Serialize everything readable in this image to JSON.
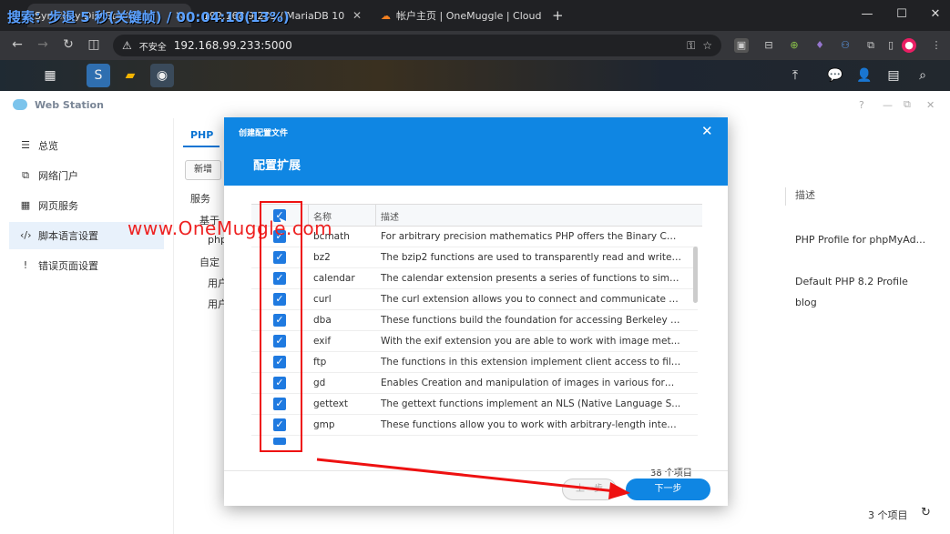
{
  "browser": {
    "overlay_text": "搜索：步退 5 秒(关键帧) / 00:04:10(13%)",
    "tabs": [
      {
        "label": "Synology DiskStation",
        "active": true
      },
      {
        "label": "192.168.9.233 / MariaDB 10",
        "active": false
      },
      {
        "label": "帐户主页 | OneMuggle | Cloud",
        "active": false
      }
    ],
    "new_tab": "+",
    "insecure_label": "不安全",
    "url": "192.168.99.233:5000"
  },
  "app": {
    "title": "Web Station",
    "sidebar": [
      {
        "label": "总览",
        "icon": "overview-icon"
      },
      {
        "label": "网络门户",
        "icon": "portal-icon"
      },
      {
        "label": "网页服务",
        "icon": "service-icon"
      },
      {
        "label": "脚本语言设置",
        "icon": "code-icon",
        "active": true
      },
      {
        "label": "错误页面设置",
        "icon": "error-page-icon"
      }
    ],
    "tab_php": "PHP",
    "add_button": "新增",
    "col_service": "服务",
    "col_desc": "描述",
    "group_based": "基于",
    "group_custom": "自定",
    "row_php": "php",
    "row_user1": "用户",
    "row_user2": "用户",
    "desc_1": "PHP Profile for phpMyAd...",
    "desc_2": "Default PHP 8.2 Profile",
    "desc_3": "blog",
    "footer_count": "3 个项目"
  },
  "modal": {
    "small_title": "创建配置文件",
    "big_title": "配置扩展",
    "col_name": "名称",
    "col_desc": "描述",
    "rows": [
      {
        "name": "bcmath",
        "desc": "For arbitrary precision mathematics PHP offers the Binary Cal..."
      },
      {
        "name": "bz2",
        "desc": "The bzip2 functions are used to transparently read and write ..."
      },
      {
        "name": "calendar",
        "desc": "The calendar extension presents a series of functions to simp..."
      },
      {
        "name": "curl",
        "desc": "The curl extension allows you to connect and communicate t..."
      },
      {
        "name": "dba",
        "desc": "These functions build the foundation for accessing Berkeley D..."
      },
      {
        "name": "exif",
        "desc": "With the exif extension you are able to work with image met..."
      },
      {
        "name": "ftp",
        "desc": "The functions in this extension implement client access to file..."
      },
      {
        "name": "gd",
        "desc": "Enables Creation and manipulation of images in various form..."
      },
      {
        "name": "gettext",
        "desc": "The gettext functions implement an NLS (Native Language S..."
      },
      {
        "name": "gmp",
        "desc": "These functions allow you to work with arbitrary-length integ..."
      }
    ],
    "count": "38 个项目",
    "prev_button": "上一步",
    "next_button": "下一步"
  },
  "watermark": "www.OneMuggle.com",
  "colors": {
    "accent": "#0f86e3",
    "annotation": "#e11111"
  }
}
